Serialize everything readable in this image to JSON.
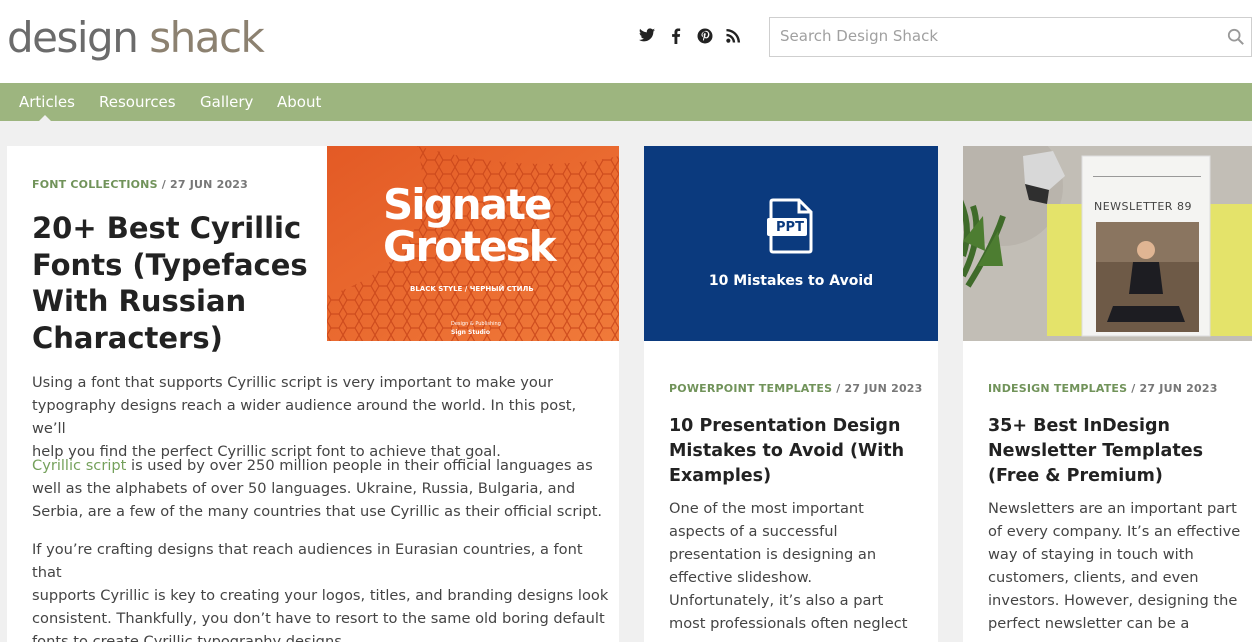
{
  "logo": {
    "part1": "design",
    "part2": "shack"
  },
  "social": {
    "twitter": "t",
    "facebook": "f",
    "pinterest": "p",
    "rss": "rss"
  },
  "search": {
    "placeholder": "Search Design Shack"
  },
  "nav": {
    "items": [
      "Articles",
      "Resources",
      "Gallery",
      "About"
    ]
  },
  "featured": {
    "category": "FONT COLLECTIONS",
    "date": " / 27 JUN 2023",
    "title_lines": [
      "20+ Best Cyrillic",
      "Fonts (Typefaces",
      "With Russian",
      "Characters)"
    ],
    "image": {
      "line1": "Signate",
      "line2": "Grotesk",
      "tag": "BLACK STYLE / ЧЕРНЫЙ СТИЛЬ",
      "credit_small": "Design & Publishing",
      "credit": "Sign Studio"
    },
    "p1": [
      "Using a font that supports Cyrillic script is very important to make your",
      "typography designs reach a wider audience around the world. In this post, we’ll",
      "help you find the perfect Cyrillic script font to achieve that goal."
    ],
    "p2_link": "Cyrillic script",
    "p2_first": " is used by over 250 million people in their official languages as",
    "p2_rest": [
      "well as the alphabets of over 50 languages. Ukraine, Russia, Bulgaria, and",
      "Serbia, are a few of the many countries that use Cyrillic as their official script."
    ],
    "p3": [
      "If you’re crafting designs that reach audiences in Eurasian countries, a font that",
      "supports Cyrillic is key to creating your logos, titles, and branding designs look",
      "consistent. Thankfully, you don’t have to resort to the same old boring default",
      "fonts to create Cyrillic typography designs."
    ]
  },
  "card2": {
    "image": {
      "badge": "PPT",
      "caption": "10 Mistakes to Avoid"
    },
    "category": "POWERPOINT TEMPLATES",
    "date": " / 27 JUN 2023",
    "title_lines": [
      "10 Presentation Design",
      "Mistakes to Avoid (With",
      "Examples)"
    ],
    "excerpt": [
      "One of the most important",
      "aspects of a successful",
      "presentation is designing an",
      "effective slideshow.",
      "Unfortunately, it’s also a part",
      "most professionals often neglect"
    ]
  },
  "card3": {
    "image": {
      "magazine_title": "NEWSLETTER 89"
    },
    "category": "INDESIGN TEMPLATES",
    "date": " / 27 JUN 2023",
    "title_lines": [
      "35+ Best InDesign",
      "Newsletter Templates",
      "(Free & Premium)"
    ],
    "excerpt": [
      "Newsletters are an important part",
      "of every company. It’s an effective",
      "way of staying in touch with",
      "customers, clients, and even",
      "investors. However, designing the",
      "perfect newsletter can be a"
    ]
  },
  "colors": {
    "nav": "#9db57f",
    "accent": "#71935a",
    "orange": "#e8632c",
    "ppt_blue": "#0b3a7e"
  }
}
